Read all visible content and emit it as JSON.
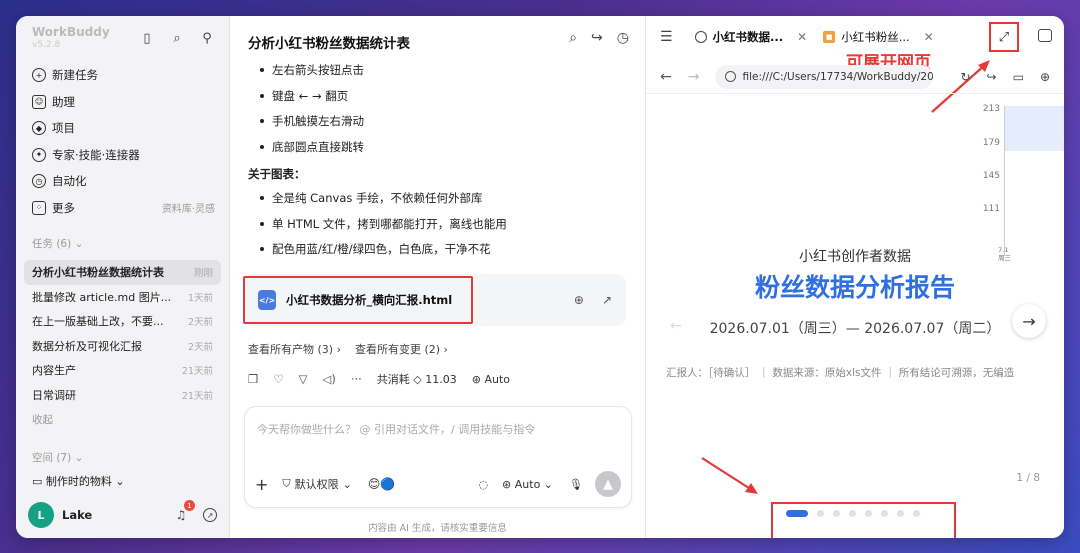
{
  "sidebar": {
    "brand": "WorkBuddy",
    "version": "v5.2.8",
    "nav": [
      {
        "label": "新建任务",
        "icon": "plus-circle-icon",
        "right": ""
      },
      {
        "label": "助理",
        "icon": "assistant-icon",
        "right": ""
      },
      {
        "label": "项目",
        "icon": "project-icon",
        "right": ""
      },
      {
        "label": "专家·技能·连接器",
        "icon": "expert-icon",
        "right": ""
      },
      {
        "label": "自动化",
        "icon": "clock-icon",
        "right": ""
      },
      {
        "label": "更多",
        "icon": "more-icon",
        "right": "资料库·灵感"
      }
    ],
    "tasks_label": "任务 (6)",
    "tasks": [
      {
        "title": "分析小红书粉丝数据统计表",
        "date": "刚刚",
        "active": true
      },
      {
        "title": "批量修改 article.md 图片...",
        "date": "1天前"
      },
      {
        "title": "在上一版基础上改，不要...",
        "date": "2天前"
      },
      {
        "title": "数据分析及可视化汇报",
        "date": "2天前"
      },
      {
        "title": "内容生产",
        "date": "21天前"
      },
      {
        "title": "日常调研",
        "date": "21天前"
      }
    ],
    "collapse": "收起",
    "space_label": "空间 (7)",
    "space_item": "制作时的物料",
    "user": {
      "name": "Lake",
      "avatar": "L",
      "badge": "1"
    }
  },
  "chat": {
    "title": "分析小红书粉丝数据统计表",
    "bullets_a": [
      "左右箭头按钮点击",
      "键盘 ← → 翻页",
      "手机触摸左右滑动",
      "底部圆点直接跳转"
    ],
    "subhead": "关于图表：",
    "bullets_b": [
      "全是纯 Canvas 手绘，不依赖任何外部库",
      "单 HTML 文件，拷到哪都能打开，离线也能用",
      "配色用蓝/红/橙/绿四色，白色底，干净不花"
    ],
    "file": {
      "icon": "</>",
      "name": "小红书数据分析_横向汇报.html"
    },
    "link_outputs": "查看所有产物 (3)",
    "link_changes": "查看所有变更 (2)",
    "cost": "共消耗 ◇ 11.03",
    "model": "Auto",
    "input_placeholder": "今天帮你做些什么？ @ 引用对话文件，/ 调用技能与指令",
    "permission": "默认权限",
    "model_select": "Auto",
    "footnote": "内容由 AI 生成，请核实重要信息"
  },
  "browser": {
    "tabs": [
      {
        "label": "小红书数据...",
        "icon": "globe-icon",
        "active": true
      },
      {
        "label": "小红书粉丝...",
        "icon": "doc-icon",
        "active": false
      }
    ],
    "annotation": "可展开网页",
    "url": "file:///C:/Users/17734/WorkBuddy/20",
    "page": {
      "y_ticks": [
        "213",
        "179",
        "145",
        "111"
      ],
      "x_label": "7.1\n周三",
      "subtitle": "小红书创作者数据",
      "title": "粉丝数据分析报告",
      "date_range": "2026.07.01（周三）— 2026.07.07（周二）",
      "footer": "汇报人：［待确认］ ｜ 数据来源：原始xls文件 ｜ 所有结论可溯源，无编造",
      "page_num": "1 / 8",
      "dots": 8,
      "active_dot": 0
    }
  },
  "colors": {
    "accent": "#2f6fe0",
    "annotation": "#e53935"
  }
}
